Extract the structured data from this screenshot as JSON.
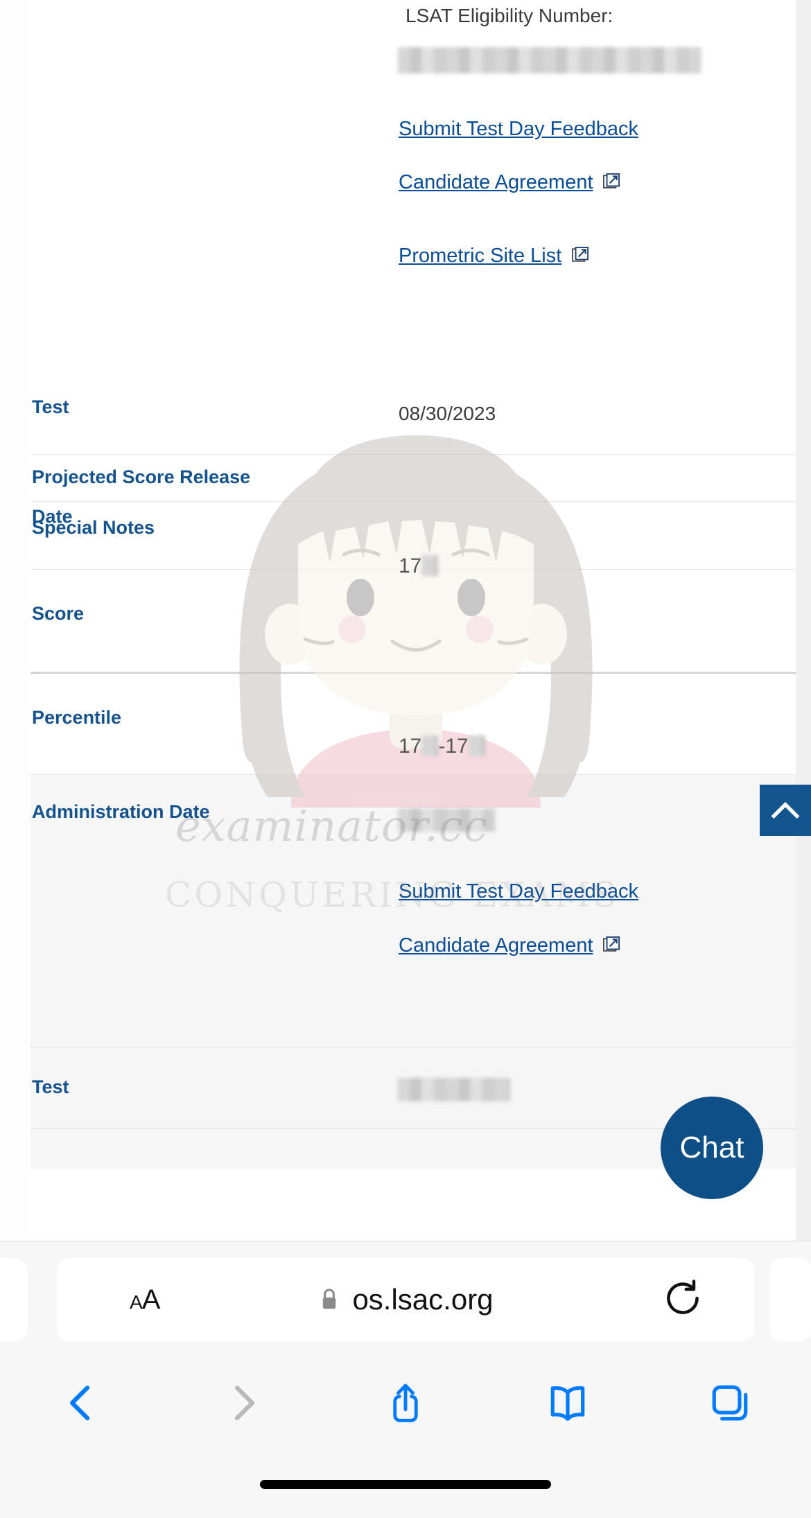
{
  "page": {
    "eligibility_label": "LSAT Eligibility Number:",
    "links": {
      "feedback": "Submit Test Day Feedback",
      "candidate_agreement": "Candidate Agreement",
      "prometric": "Prometric Site List"
    },
    "rows": [
      {
        "label": "Test",
        "value": "08/30/2023"
      },
      {
        "label": "Projected Score Release",
        "value": ""
      },
      {
        "label": "Date",
        "value": ""
      },
      {
        "label": "Special Notes",
        "value": ""
      },
      {
        "label": "Score",
        "value": ""
      },
      {
        "label": "Percentile",
        "value": ""
      },
      {
        "label": "Administration Date",
        "value": ""
      },
      {
        "label": "Test",
        "value": ""
      }
    ],
    "watermark": {
      "line1": "examinator.cc",
      "line2": "CONQUERING EXAMS"
    },
    "chat_button": "Chat",
    "scroll_top_icon": "chevron-up-icon",
    "accent_blue": "#0b4d96",
    "label_blue": "#15538e"
  },
  "browser": {
    "url": "os.lsac.org",
    "secure_icon": "lock-icon",
    "text_size_label": "AA",
    "reload_icon": "reload-icon",
    "toolbar": [
      {
        "name": "back",
        "icon": "chevron-left-icon",
        "enabled": true
      },
      {
        "name": "forward",
        "icon": "chevron-right-icon",
        "enabled": false
      },
      {
        "name": "share",
        "icon": "share-icon",
        "enabled": true
      },
      {
        "name": "bookmarks",
        "icon": "book-icon",
        "enabled": true
      },
      {
        "name": "tabs",
        "icon": "tabs-icon",
        "enabled": true
      }
    ],
    "tint": "#007aff",
    "disabled_tint": "#b9b9b9"
  }
}
